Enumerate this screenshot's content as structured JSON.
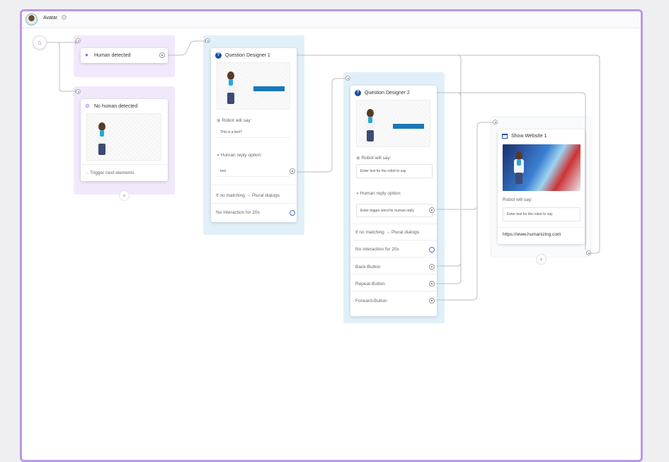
{
  "topbar": {
    "title": "Avatar"
  },
  "nodes": {
    "human_detected": {
      "title": "Human detected"
    },
    "no_human_detected": {
      "title": "No human detected",
      "trigger_label": "Trigger next elements"
    },
    "qd1": {
      "title": "Question Designer 1",
      "robot_say_label": "Robot will say:",
      "robot_say_value": "This is a test?",
      "reply_label": "Human reply option:",
      "reply_value": "test",
      "no_match": "If no matching → Plural dialogs",
      "no_interaction": "No interaction for 20s"
    },
    "qd2": {
      "title": "Question Designer 2",
      "robot_say_label": "Robot will say:",
      "robot_say_placeholder": "Enter text for the robot to say",
      "reply_label": "Human reply option:",
      "reply_placeholder": "Enter trigger word for human reply",
      "no_match": "If no matching → Plural dialogs",
      "no_interaction": "No interaction for 20s",
      "back": "Back-Button",
      "repeat": "Repeat-Button",
      "forward": "Forward-Button"
    },
    "website": {
      "title": "Show Website 1",
      "robot_say_label": "Robot will say:",
      "robot_say_placeholder": "Enter text for the robot to say",
      "url": "https://www.humanizing.com"
    }
  },
  "colors": {
    "accent_purple": "#b99ae6",
    "group_purple": "#f1e9fb",
    "group_blue": "#e1f0f8",
    "button_blue": "#1978b8"
  },
  "icons": [
    "home-icon",
    "gear-icon",
    "person-icon",
    "no-person-icon",
    "help-icon",
    "speech-icon",
    "browser-icon",
    "arrow-down-icon",
    "plus-icon"
  ]
}
